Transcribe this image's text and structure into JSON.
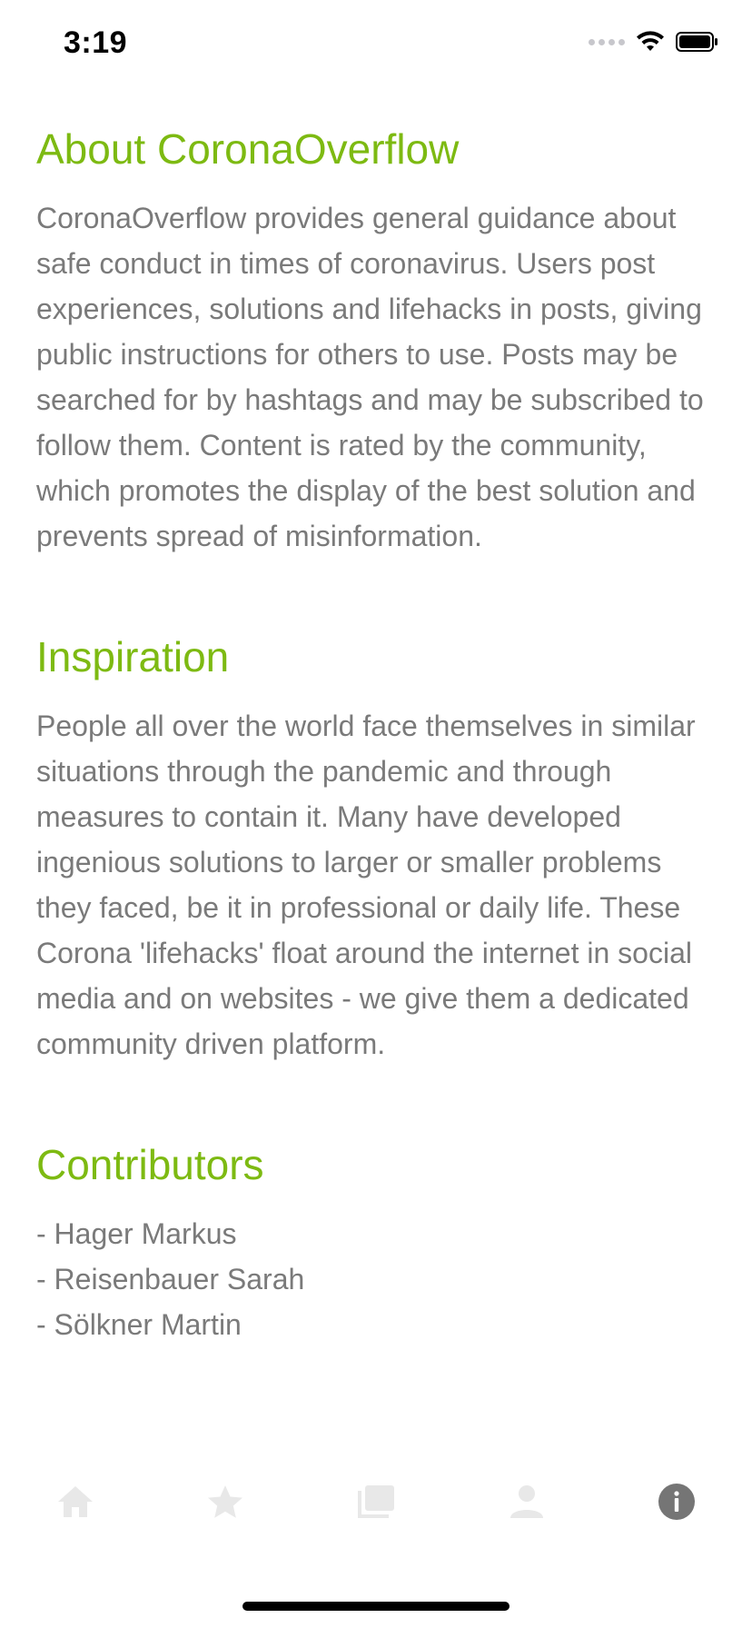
{
  "status_bar": {
    "time": "3:19"
  },
  "sections": [
    {
      "title": "About CoronaOverflow",
      "text": "CoronaOverflow provides general guidance about safe conduct in times of coronavirus. Users post experiences, solutions and lifehacks in posts, giving public instructions for others to use. Posts may be searched for by hashtags and may be subscribed to follow them. Content is rated by the community, which promotes the display of the best solution and prevents spread of misinformation."
    },
    {
      "title": "Inspiration",
      "text": "People all over the world face themselves in similar situations through the pandemic and through measures to contain it. Many have developed ingenious solutions to larger or smaller problems they faced, be it in professional or daily life. These Corona 'lifehacks' float around the internet in social media and on websites - we give them a dedicated community driven platform."
    }
  ],
  "contributors": {
    "title": "Contributors",
    "items": [
      "- Hager Markus",
      "- Reisenbauer Sarah",
      "- Sölkner Martin"
    ]
  },
  "tab_bar": {
    "items": [
      {
        "icon": "home-icon",
        "active": false
      },
      {
        "icon": "star-icon",
        "active": false
      },
      {
        "icon": "posts-icon",
        "active": false
      },
      {
        "icon": "person-icon",
        "active": false
      },
      {
        "icon": "info-icon",
        "active": true
      }
    ]
  },
  "colors": {
    "accent": "#7dba12",
    "body_text": "#7a7a7a",
    "tab_inactive": "#e8e8e8",
    "tab_active": "#757575"
  }
}
